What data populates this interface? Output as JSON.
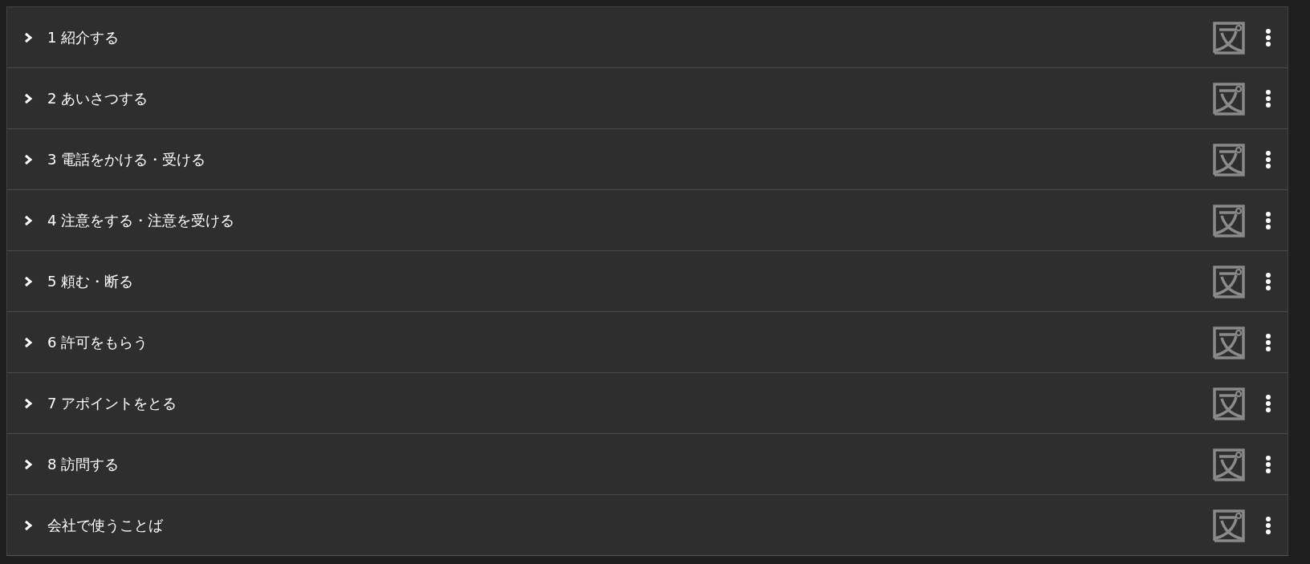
{
  "sections": [
    {
      "title": "1 紹介する",
      "expanded": false
    },
    {
      "title": "2 あいさつする",
      "expanded": false
    },
    {
      "title": "3 電話をかける・受ける",
      "expanded": false
    },
    {
      "title": "4 注意をする・注意を受ける",
      "expanded": false
    },
    {
      "title": "5 頼む・断る",
      "expanded": false
    },
    {
      "title": "6 許可をもらう",
      "expanded": false
    },
    {
      "title": "7 アポイントをとる",
      "expanded": false
    },
    {
      "title": "8 訪問する",
      "expanded": false
    },
    {
      "title": "会社で使うことば",
      "expanded": false
    }
  ]
}
